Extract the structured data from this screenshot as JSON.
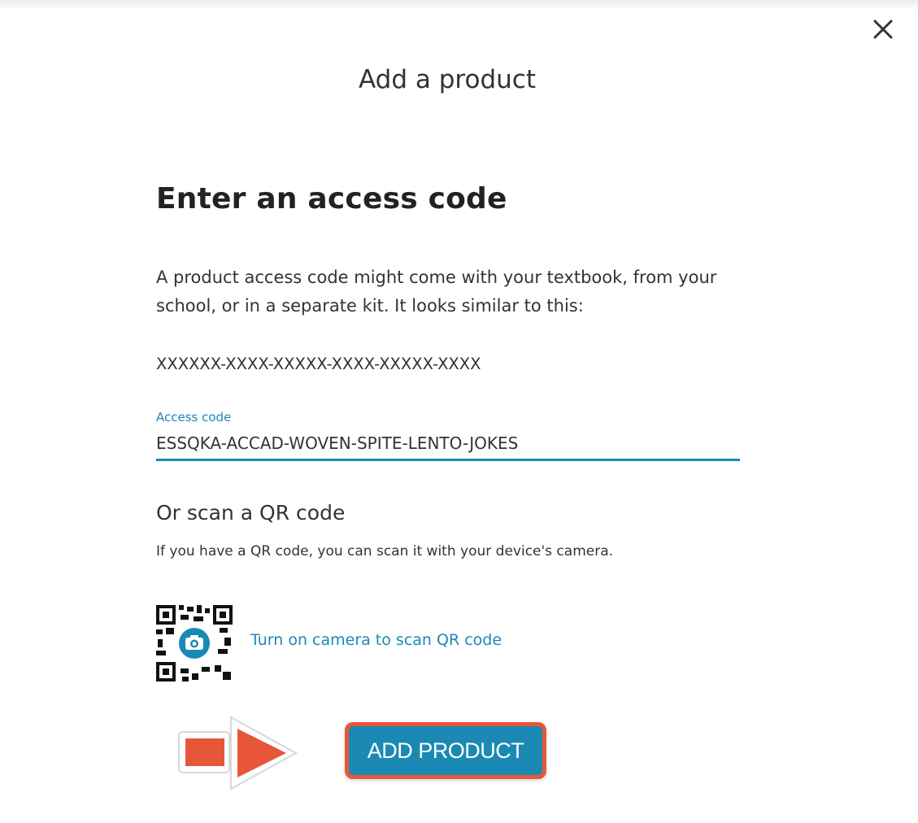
{
  "modal": {
    "title": "Add a product",
    "close_icon": "close-icon"
  },
  "access_code_section": {
    "heading": "Enter an access code",
    "description": "A product access code might come with your textbook, from your school, or in a separate kit. It looks similar to this:",
    "format_example": "XXXXXX-XXXX-XXXXX-XXXX-XXXXX-XXXX",
    "field_label": "Access code",
    "field_value": "ESSQKA-ACCAD-WOVEN-SPITE-LENTO-JOKES"
  },
  "qr_section": {
    "heading": "Or scan a QR code",
    "description": "If you have a QR code, you can scan it with your device's camera.",
    "camera_link": "Turn on camera to scan QR code",
    "icon": "qr-camera-icon"
  },
  "actions": {
    "add_product_label": "ADD PRODUCT"
  },
  "colors": {
    "accent": "#1a8ab5",
    "highlight": "#e8563a",
    "text": "#333333"
  }
}
